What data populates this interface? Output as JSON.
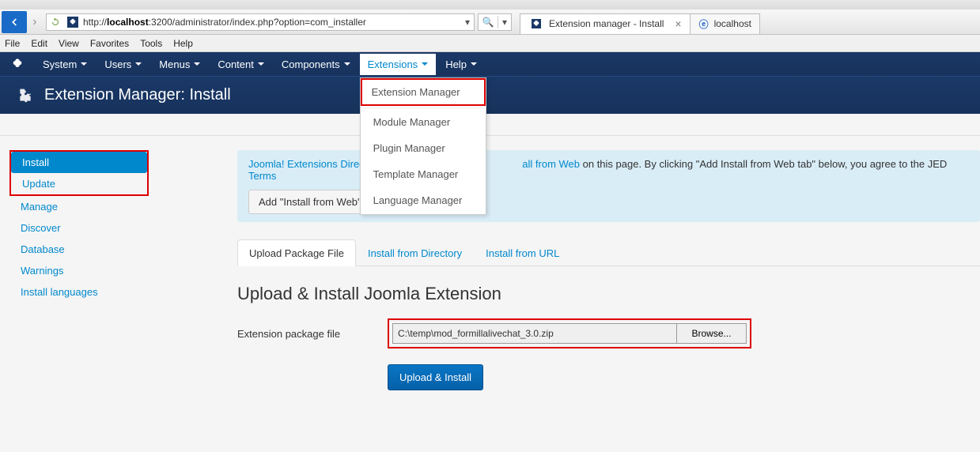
{
  "browser": {
    "url_prefix": "http://",
    "url_host": "localhost",
    "url_rest": ":3200/administrator/index.php?option=com_installer",
    "tab1": "Extension manager - Install",
    "tab2": "localhost",
    "menus": [
      "File",
      "Edit",
      "View",
      "Favorites",
      "Tools",
      "Help"
    ]
  },
  "nav": {
    "items": [
      "System",
      "Users",
      "Menus",
      "Content",
      "Components",
      "Extensions",
      "Help"
    ]
  },
  "dropdown": {
    "highlighted": "Extension Manager",
    "items": [
      "Module Manager",
      "Plugin Manager",
      "Template Manager",
      "Language Manager"
    ]
  },
  "page": {
    "title": "Extension Manager: Install"
  },
  "sidebar": {
    "items": [
      "Install",
      "Update",
      "Manage",
      "Discover",
      "Database",
      "Warnings",
      "Install languages"
    ]
  },
  "info": {
    "prefix": "Joomla! Extensions Directory (",
    "middle": "all from Web",
    "suffix": " on this page.  By clicking \"Add Install from Web tab\" below, you agree to the JED ",
    "terms": "Terms",
    "button": "Add \"Install from Web\" tab"
  },
  "tabs": {
    "items": [
      "Upload Package File",
      "Install from Directory",
      "Install from URL"
    ]
  },
  "form": {
    "heading": "Upload & Install Joomla Extension",
    "label": "Extension package file",
    "value": "C:\\temp\\mod_formillalivechat_3.0.zip",
    "browse": "Browse...",
    "submit": "Upload & Install"
  }
}
